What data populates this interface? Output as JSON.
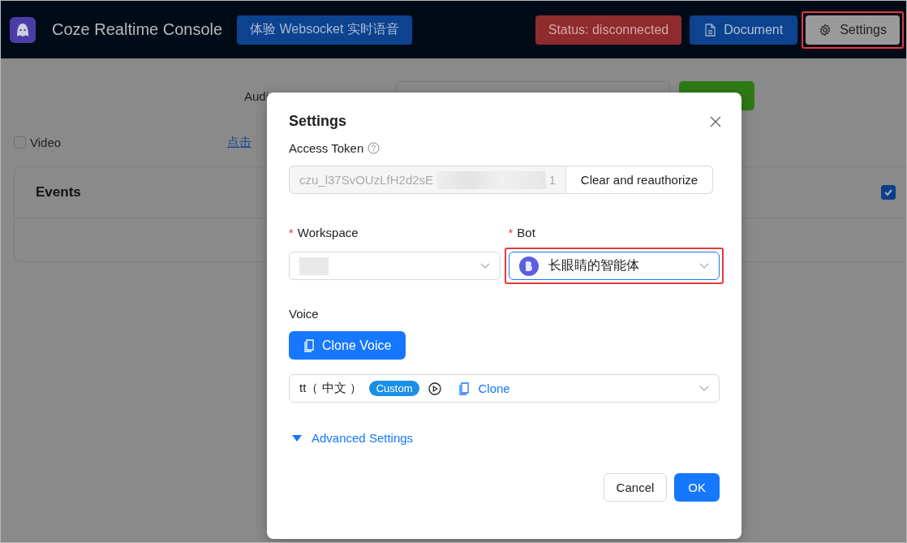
{
  "header": {
    "title": "Coze Realtime Console",
    "promo_button": "体验 Websocket 实时语音",
    "status": "Status: disconnected",
    "document_button": "Document",
    "settings_button": {
      "label": "Settings",
      "highlighted": true
    }
  },
  "toolbar": {
    "audio_label": "Audi",
    "link": "点击"
  },
  "video": {
    "label": "Video",
    "checked": false
  },
  "events": {
    "title": "Events",
    "checked": true
  },
  "modal": {
    "title": "Settings",
    "access_token": {
      "label": "Access Token",
      "value": "czu_l37SvOUzLfH2d2sE",
      "value_tail": "1",
      "button": "Clear and reauthorize"
    },
    "workspace": {
      "label": "Workspace",
      "mark": "*",
      "highlighted": false
    },
    "bot": {
      "label": "Bot",
      "mark": "*",
      "value": "长眼睛的智能体",
      "highlighted": true
    },
    "voice": {
      "label": "Voice",
      "clone_button": "Clone Voice",
      "name": "tt（ 中文 ）",
      "tag": "Custom",
      "clone_link": "Clone"
    },
    "advanced": {
      "label": "Advanced Settings"
    },
    "buttons": {
      "cancel": "Cancel",
      "ok": "OK"
    }
  }
}
